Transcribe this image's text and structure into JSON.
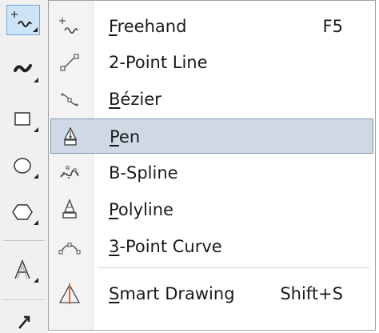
{
  "toolbox": {
    "tools": [
      {
        "name": "freehand-tool",
        "icon": "freehand-icon",
        "active": true
      },
      {
        "name": "artistic-media-tool",
        "icon": "artistic-media-icon",
        "active": false
      },
      {
        "name": "rectangle-tool",
        "icon": "rectangle-icon",
        "active": false
      },
      {
        "name": "ellipse-tool",
        "icon": "ellipse-icon",
        "active": false
      },
      {
        "name": "polygon-tool",
        "icon": "polygon-icon",
        "active": false
      },
      {
        "name": "text-tool",
        "icon": "text-icon",
        "active": false
      },
      {
        "name": "pick-tool",
        "icon": "pick-icon",
        "active": false
      }
    ]
  },
  "menu": {
    "items": [
      {
        "id": "freehand",
        "mnemonic": "F",
        "rest": "reehand",
        "shortcut": "F5",
        "icon": "freehand-icon"
      },
      {
        "id": "2-point-line",
        "mnemonic": "",
        "rest": "2-Point Line",
        "shortcut": "",
        "icon": "two-point-line-icon"
      },
      {
        "id": "bezier",
        "mnemonic": "B",
        "rest": "ézier",
        "shortcut": "",
        "icon": "bezier-icon"
      },
      {
        "id": "pen",
        "mnemonic": "P",
        "rest": "en",
        "shortcut": "",
        "icon": "pen-nib-icon",
        "highlighted": true
      },
      {
        "id": "b-spline",
        "mnemonic": "",
        "rest": "B-Spline",
        "shortcut": "",
        "icon": "b-spline-icon"
      },
      {
        "id": "polyline",
        "mnemonic": "P",
        "rest": "olyline",
        "shortcut": "",
        "icon": "polyline-icon"
      },
      {
        "id": "3-point-curve",
        "mnemonic": "3",
        "rest": "-Point Curve",
        "shortcut": "",
        "icon": "three-point-curve-icon"
      },
      {
        "id": "smart-drawing",
        "mnemonic": "S",
        "rest": "mart Drawing",
        "shortcut": "Shift+S",
        "icon": "smart-drawing-icon"
      }
    ]
  }
}
